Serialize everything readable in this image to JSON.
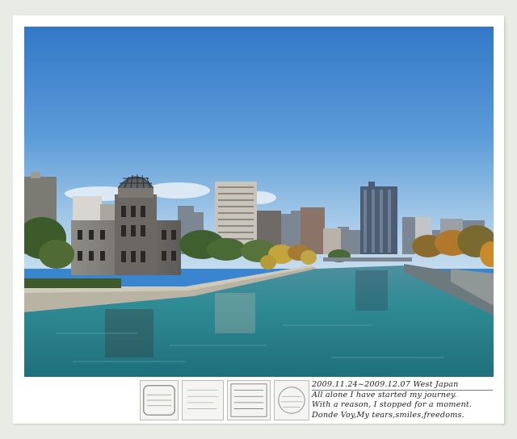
{
  "caption": {
    "date_line": "2009.11.24~2009.12.07 West Japan",
    "line_1": "All alone I have started my journey.",
    "line_2": "With a reason, I stopped for a moment.",
    "line_3": "Donde Voy,My tears,smiles,freedoms."
  },
  "colors": {
    "sky_top": "#3b84d0",
    "sky_bottom": "#bcd8ec",
    "water": "#2f8e96",
    "frame": "#ffffff",
    "background": "#e9ebe5"
  }
}
